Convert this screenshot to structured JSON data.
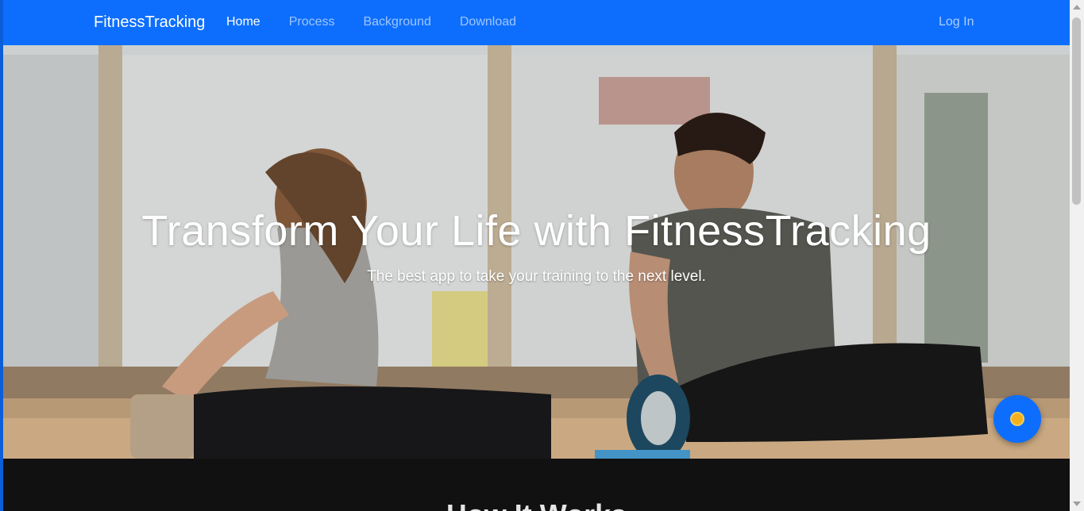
{
  "navbar": {
    "brand": "FitnessTracking",
    "links": [
      {
        "label": "Home",
        "active": true
      },
      {
        "label": "Process",
        "active": false
      },
      {
        "label": "Background",
        "active": false
      },
      {
        "label": "Download",
        "active": false
      }
    ],
    "login": "Log In",
    "color": "#0d6efd"
  },
  "hero": {
    "title": "Transform Your Life with FitnessTracking",
    "subtitle": "The best app to take your training to the next level."
  },
  "next_section": {
    "title": "How It Works"
  },
  "fab": {
    "icon": "sun-icon"
  }
}
